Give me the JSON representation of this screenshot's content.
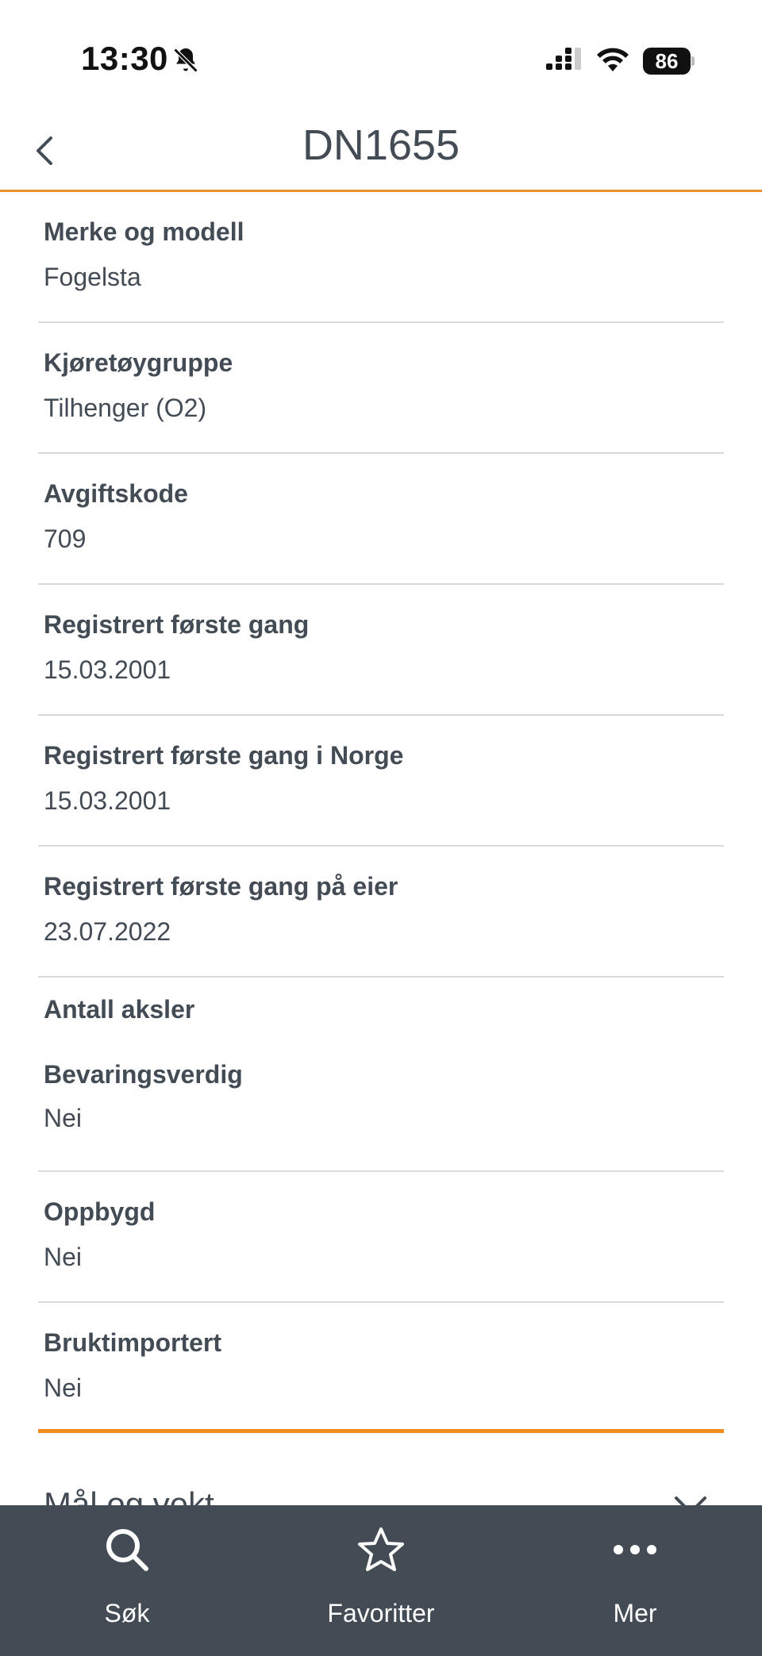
{
  "status_bar": {
    "time": "13:30",
    "battery": "86"
  },
  "header": {
    "title": "DN1655"
  },
  "details": [
    {
      "label": "Merke og modell",
      "value": "Fogelsta"
    },
    {
      "label": "Kjøretøygruppe",
      "value": "Tilhenger (O2)"
    },
    {
      "label": "Avgiftskode",
      "value": "709"
    },
    {
      "label": "Registrert første gang",
      "value": "15.03.2001"
    },
    {
      "label": "Registrert første gang i Norge",
      "value": "15.03.2001"
    },
    {
      "label": "Registrert første gang på eier",
      "value": "23.07.2022"
    },
    {
      "label": "Antall aksler"
    },
    {
      "label": "Bevaringsverdig",
      "value": "Nei"
    },
    {
      "label": "Oppbygd",
      "value": "Nei"
    },
    {
      "label": "Bruktimportert",
      "value": "Nei"
    }
  ],
  "section": {
    "title": "Mål og vekt"
  },
  "tabs": [
    {
      "label": "Søk",
      "icon": "search-icon"
    },
    {
      "label": "Favoritter",
      "icon": "star-icon"
    },
    {
      "label": "Mer",
      "icon": "more-icon"
    }
  ],
  "colors": {
    "accent": "#e8912a",
    "text": "#434b54",
    "tab_bar": "#434b54"
  }
}
